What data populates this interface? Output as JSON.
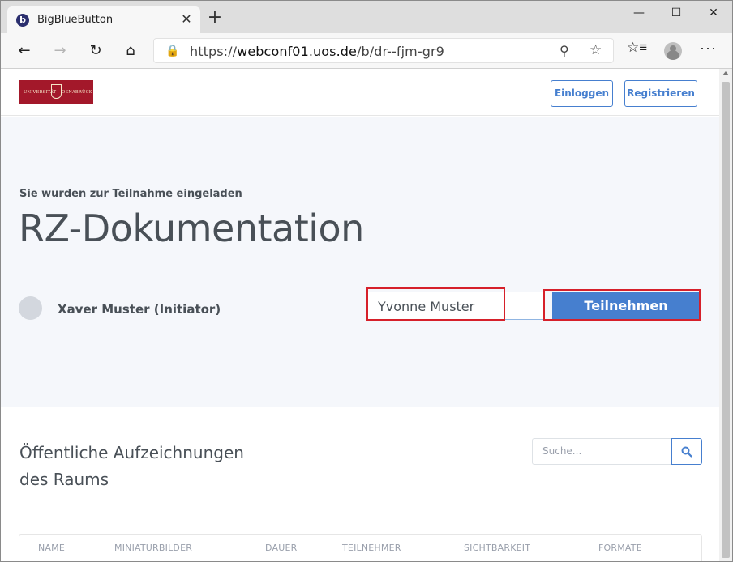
{
  "browser": {
    "tab_title": "BigBlueButton",
    "tab_favicon": "b",
    "tab_close": "✕",
    "new_tab": "+",
    "url_prefix": "https://",
    "url_host": "webconf01.uos.de",
    "url_path": "/b/dr--fjm-gr9"
  },
  "header": {
    "logo_left": "UNIVERSITÄT",
    "logo_right": "OSNABRÜCK",
    "login_label": "Einloggen",
    "register_label": "Registrieren"
  },
  "hero": {
    "invited_text": "Sie wurden zur Teilnahme eingeladen",
    "room_title": "RZ-Dokumentation",
    "owner_name": "Xaver Muster (Initiator)",
    "name_input_value": "Yvonne Muster",
    "join_label": "Teilnehmen"
  },
  "recordings": {
    "title_line1": "Öffentliche Aufzeichnungen",
    "title_line2": "des Raums",
    "search_placeholder": "Suche...",
    "columns": [
      "NAME",
      "MINIATURBILDER",
      "DAUER",
      "TEILNEHMER",
      "SICHTBARKEIT",
      "FORMATE"
    ]
  },
  "colors": {
    "primary": "#467fcf",
    "highlight": "#d6202a",
    "hero_bg": "#f5f7fb",
    "logo_bg": "#a3182a"
  }
}
